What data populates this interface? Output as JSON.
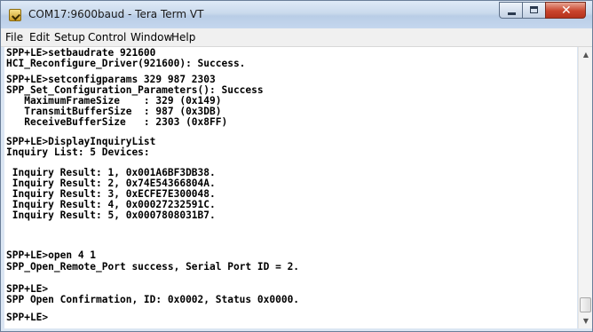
{
  "window": {
    "title": "COM17:9600baud - Tera Term VT"
  },
  "menu": [
    "File",
    "Edit",
    "Setup",
    "Control",
    "Window",
    "Help"
  ],
  "terminal": {
    "lines": [
      "SPP+LE>setbaudrate 921600",
      "HCI_Reconfigure_Driver(921600): Success.",
      "SPP+LE>setconfigparams 329 987 2303",
      "SPP_Set_Configuration_Parameters(): Success",
      "   MaximumFrameSize    : 329 (0x149)",
      "   TransmitBufferSize  : 987 (0x3DB)",
      "   ReceiveBufferSize   : 2303 (0x8FF)",
      "SPP+LE>DisplayInquiryList",
      "Inquiry List: 5 Devices:",
      " Inquiry Result: 1, 0x001A6BF3DB38.",
      " Inquiry Result: 2, 0x74E54366804A.",
      " Inquiry Result: 3, 0xECFE7E300048.",
      " Inquiry Result: 4, 0x00027232591C.",
      " Inquiry Result: 5, 0x0007808031B7.",
      "SPP+LE>open 4 1",
      "SPP_Open_Remote_Port success, Serial Port ID = 2.",
      "SPP+LE>",
      "SPP Open Confirmation, ID: 0x0002, Status 0x0000.",
      "SPP+LE>"
    ]
  },
  "icons": {
    "app": "tera-term-icon",
    "minimize": "minimize-icon",
    "maximize": "maximize-icon",
    "close": "close-icon"
  }
}
